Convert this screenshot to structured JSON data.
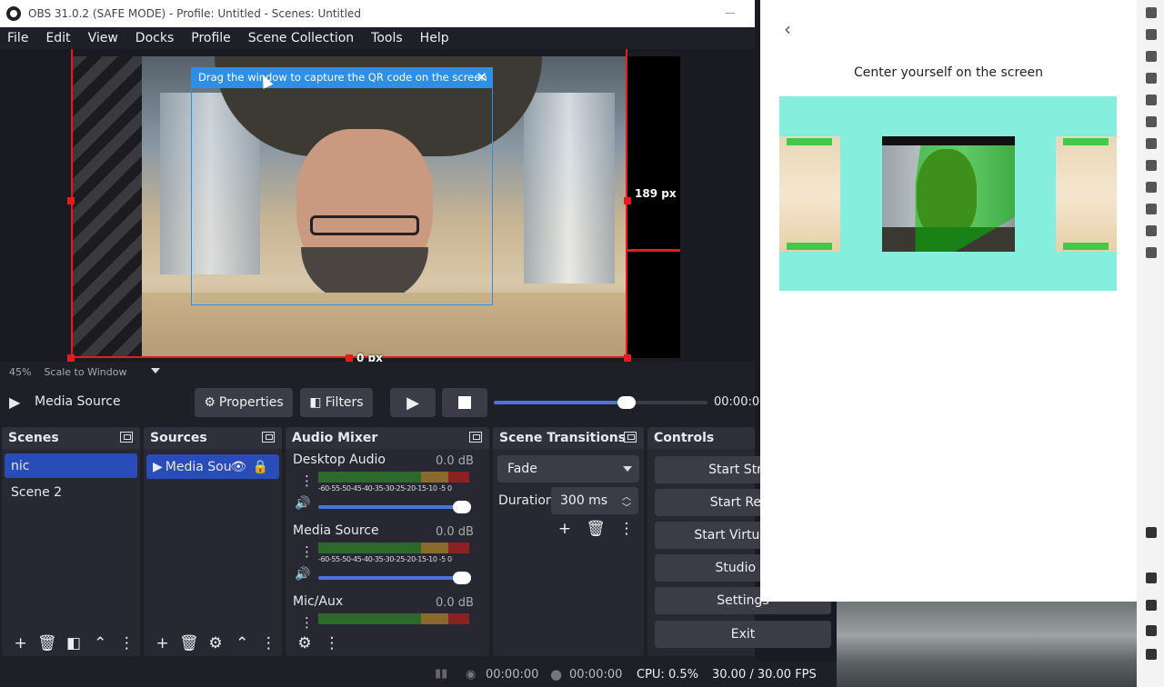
{
  "obs": {
    "title": "OBS 31.0.2 (SAFE MODE) - Profile: Untitled - Scenes: Untitled",
    "menu": [
      "File",
      "Edit",
      "View",
      "Docks",
      "Profile",
      "Scene Collection",
      "Tools",
      "Help"
    ],
    "preview": {
      "right_px_label": "189 px",
      "bottom_px_label": "0 px",
      "qr_hint": "Drag the window to capture the QR code on the screen"
    },
    "status": {
      "zoom": "45%",
      "scale_mode": "Scale to Window"
    },
    "source_bar": {
      "source_name": "Media Source",
      "properties_label": "Properties",
      "filters_label": "Filters",
      "time": "00:00:0",
      "seek_fraction": 0.62
    },
    "scenes": {
      "title": "Scenes",
      "items": [
        "nic",
        "Scene 2"
      ],
      "selected": 0
    },
    "sources": {
      "title": "Sources",
      "items": [
        "Media Sou"
      ]
    },
    "audio_mixer": {
      "title": "Audio Mixer",
      "scale": "-60-55-50-45-40-35-30-25-20-15-10 -5  0",
      "channels": [
        {
          "name": "Desktop Audio",
          "db": "0.0 dB",
          "volume_fraction": 1.0
        },
        {
          "name": "Media Source",
          "db": "0.0 dB",
          "volume_fraction": 1.0
        },
        {
          "name": "Mic/Aux",
          "db": "0.0 dB",
          "volume_fraction": 1.0
        }
      ]
    },
    "scene_transitions": {
      "title": "Scene Transitions",
      "transition": "Fade",
      "duration_label": "Duration",
      "duration_value": "300 ms"
    },
    "controls": {
      "title": "Controls",
      "buttons": [
        "Start Strea",
        "Start Reco",
        "Start Virtual Ca",
        "Studio M",
        "Settings",
        "Exit"
      ]
    },
    "bottom": {
      "stream_time": "00:00:00",
      "record_time": "00:00:00",
      "cpu": "CPU: 0.5%",
      "fps": "30.00 / 30.00 FPS"
    }
  },
  "panel": {
    "title": "Center yourself on the screen"
  }
}
